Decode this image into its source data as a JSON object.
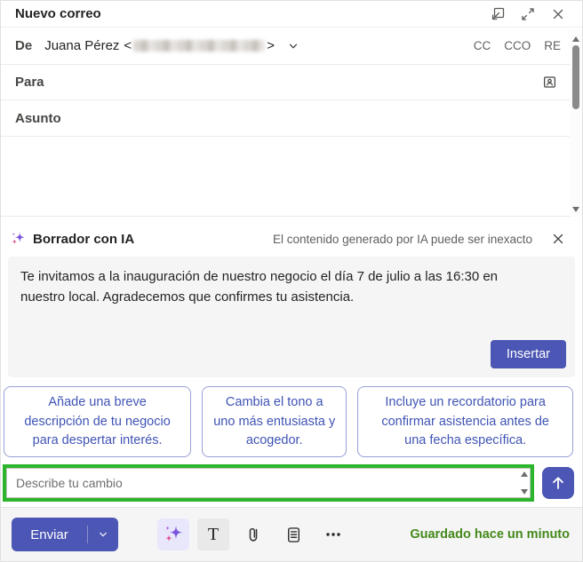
{
  "window": {
    "title": "Nuevo correo"
  },
  "compose": {
    "from_label": "De",
    "from_name": "Juana Pérez",
    "from_open_bracket": "<",
    "from_close_bracket": ">",
    "cc_label": "CC",
    "cco_label": "CCO",
    "re_label": "RE",
    "to_label": "Para",
    "subject_label": "Asunto"
  },
  "copilot": {
    "title": "Borrador con IA",
    "disclaimer": "El contenido generado por IA puede ser inexacto",
    "draft_text": "Te invitamos a la inauguración de nuestro negocio el día 7 de julio a las 16:30 en nuestro local. Agradecemos que confirmes tu asistencia.",
    "insert_button_label": "Insertar",
    "suggestions": [
      "Añade una breve descripción de tu negocio para despertar interés.",
      "Cambia el tono a uno más entusiasta y acogedor.",
      "Incluye un recordatorio para confirmar asistencia antes de una fecha específica."
    ],
    "change_input_placeholder": "Describe tu cambio"
  },
  "toolbar": {
    "send_label": "Enviar",
    "saved_status": "Guardado hace un minuto"
  },
  "colors": {
    "accent_blue": "#4c56b4",
    "suggestion_text": "#3f54b4",
    "annotation_green": "#2cb52c",
    "saved_green": "#44891b"
  }
}
